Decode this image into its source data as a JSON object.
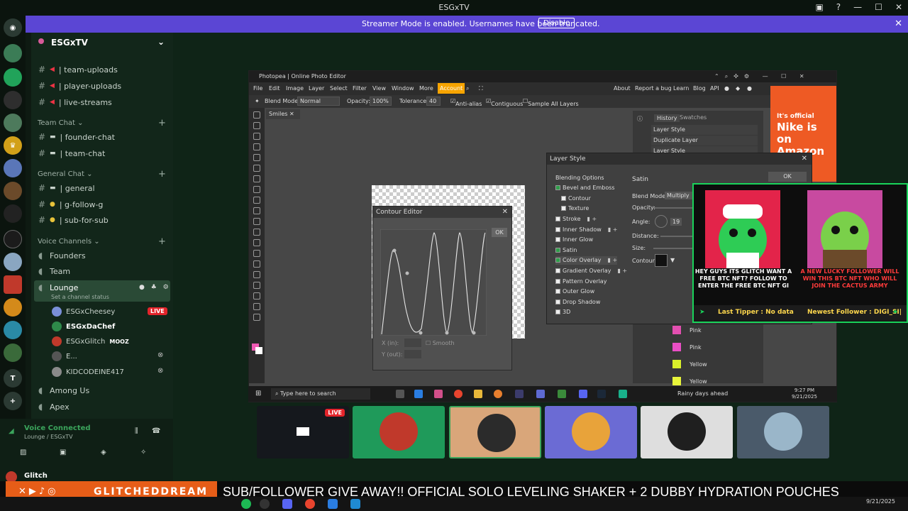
{
  "titlebar": {
    "title": "ESGxTV"
  },
  "streamer_banner": {
    "message": "Streamer Mode is enabled. Usernames have been truncated.",
    "disable_label": "Disable"
  },
  "server": {
    "name": "ESGxTV"
  },
  "channels": {
    "top": [
      {
        "name": "| team-uploads"
      },
      {
        "name": "| player-uploads"
      },
      {
        "name": "| live-streams"
      }
    ],
    "categories": [
      {
        "name": "Team Chat",
        "channels": [
          {
            "name": "| founder-chat"
          },
          {
            "name": "| team-chat"
          }
        ]
      },
      {
        "name": "General Chat",
        "channels": [
          {
            "name": "| general"
          },
          {
            "name": "| g-follow-g"
          },
          {
            "name": "| sub-for-sub"
          }
        ]
      }
    ],
    "voice_category": "Voice Channels",
    "voice": [
      {
        "name": "Founders"
      },
      {
        "name": "Team"
      },
      {
        "name": "Lounge"
      }
    ],
    "lounge_status": "Set a channel status",
    "lounge_users": [
      {
        "name": "ESGxCheesey",
        "badge": "LIVE"
      },
      {
        "name": "ESGxDaChef"
      },
      {
        "name": "ESGxGlitch",
        "tag": "MOOZ"
      },
      {
        "name": "E..."
      },
      {
        "name": "KIDCODEINE417"
      }
    ],
    "more_voice": [
      {
        "name": "Among Us"
      },
      {
        "name": "Apex"
      }
    ]
  },
  "voice_panel": {
    "status": "Voice Connected",
    "location": "Lounge / ESGxTV",
    "user": "Glitch"
  },
  "photopea": {
    "title": "Photopea | Online Photo Editor",
    "menu": [
      "File",
      "Edit",
      "Image",
      "Layer",
      "Select",
      "Filter",
      "View",
      "Window",
      "More",
      "Account"
    ],
    "right_menu": [
      "About",
      "Report a bug",
      "Learn",
      "Blog",
      "API"
    ],
    "options": {
      "blend_mode_label": "Blend Mode:",
      "blend_mode": "Normal",
      "opacity_label": "Opacity:",
      "opacity": "100%",
      "tolerance_label": "Tolerance:",
      "tolerance": "40",
      "anti_alias": "Anti-alias",
      "contiguous": "Contiguous",
      "sample_all": "Sample All Layers"
    },
    "doc_tab": "Smiles",
    "panel_tabs": [
      "History",
      "Swatches"
    ],
    "history": [
      "Layer Style",
      "Duplicate Layer",
      "Layer Style"
    ],
    "swatches": [
      {
        "name": "Pink",
        "color": "#e34fb0"
      },
      {
        "name": "Pink",
        "color": "#ea4fc6"
      },
      {
        "name": "Yellow",
        "color": "#d9f02a"
      },
      {
        "name": "Yellow",
        "color": "#e8f53a"
      }
    ]
  },
  "layer_style": {
    "title": "Layer Style",
    "ok_label": "OK",
    "section_title": "Satin",
    "items": [
      {
        "label": "Blending Options",
        "checkbox": false,
        "header": true
      },
      {
        "label": "Bevel and Emboss",
        "checked": true
      },
      {
        "label": "Contour",
        "checked": false,
        "indent": true
      },
      {
        "label": "Texture",
        "checked": false,
        "indent": true
      },
      {
        "label": "Stroke",
        "checked": false
      },
      {
        "label": "Inner Shadow",
        "checked": false
      },
      {
        "label": "Inner Glow",
        "checked": false
      },
      {
        "label": "Satin",
        "checked": true
      },
      {
        "label": "Color Overlay",
        "checked": true
      },
      {
        "label": "Gradient Overlay",
        "checked": false
      },
      {
        "label": "Pattern Overlay",
        "checked": false
      },
      {
        "label": "Outer Glow",
        "checked": false
      },
      {
        "label": "Drop Shadow",
        "checked": false
      },
      {
        "label": "3D",
        "checked": false
      }
    ],
    "blend_mode_label": "Blend Mode:",
    "blend_mode": "Multiply",
    "opacity_label": "Opacity:",
    "angle_label": "Angle:",
    "angle": "19",
    "distance_label": "Distance:",
    "size_label": "Size:",
    "contour_label": "Contour:"
  },
  "contour_editor": {
    "title": "Contour Editor",
    "ok_label": "OK",
    "x_label": "X (in):",
    "y_label": "Y (out):",
    "smooth_label": "Smooth"
  },
  "ad": {
    "line1": "It's official",
    "line2": "Nike is on Amazon"
  },
  "inner_taskbar": {
    "search": "Type here to search",
    "weather": "Rainy days ahead",
    "time": "9:27 PM",
    "date": "9/21/2025"
  },
  "overlay": {
    "left_text": "HEY GUYS ITS GLITCH WANT A FREE BTC NFT? FOLLOW TO ENTER THE FREE BTC NFT GI",
    "right_text": "A NEW LUCKY FOLLOWER WILL WIN THIS BTC NFT WHO WILL JOIN THE CACTUS ARMY",
    "last_tipper": "Last Tipper : No data",
    "newest_follower": "Newest Follower : DIGI_SI|"
  },
  "thumbnails": [
    {
      "badge": "LIVE"
    },
    {},
    {},
    {},
    {},
    {}
  ],
  "ticker": {
    "brand": "GLITCHEDDREAM",
    "message": "SUB/FOLLOWER GIVE AWAY!! OFFICIAL SOLO LEVELING SHAKER + 2 DUBBY HYDRATION POUCHES"
  },
  "outer_taskbar": {
    "date": "9/21/2025"
  },
  "colors": {
    "discord_accent": "#5b46d4",
    "overlay_green": "#19d35a",
    "brand_orange": "#e65d18"
  }
}
